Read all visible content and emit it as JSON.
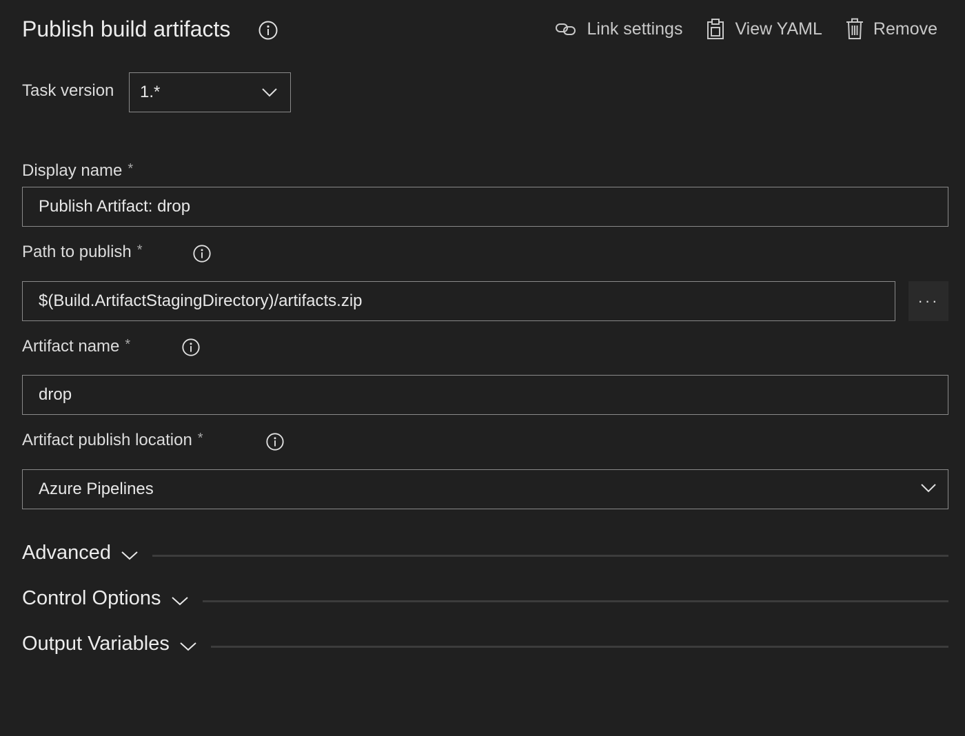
{
  "header": {
    "title": "Publish build artifacts",
    "actions": {
      "link_settings": "Link settings",
      "view_yaml": "View YAML",
      "remove": "Remove"
    }
  },
  "task_version": {
    "label": "Task version",
    "value": "1.*"
  },
  "fields": {
    "display_name": {
      "label": "Display name",
      "required": "*",
      "value": "Publish Artifact: drop"
    },
    "path_to_publish": {
      "label": "Path to publish",
      "required": "*",
      "value": "$(Build.ArtifactStagingDirectory)/artifacts.zip",
      "browse": "···"
    },
    "artifact_name": {
      "label": "Artifact name",
      "required": "*",
      "value": "drop"
    },
    "artifact_publish_location": {
      "label": "Artifact publish location",
      "required": "*",
      "value": "Azure Pipelines"
    }
  },
  "sections": {
    "advanced": "Advanced",
    "control_options": "Control Options",
    "output_variables": "Output Variables"
  },
  "icons": {
    "info": "info-icon",
    "link": "link-icon",
    "yaml": "clipboard-icon",
    "remove": "trash-icon",
    "chevron": "chevron-down-icon"
  }
}
